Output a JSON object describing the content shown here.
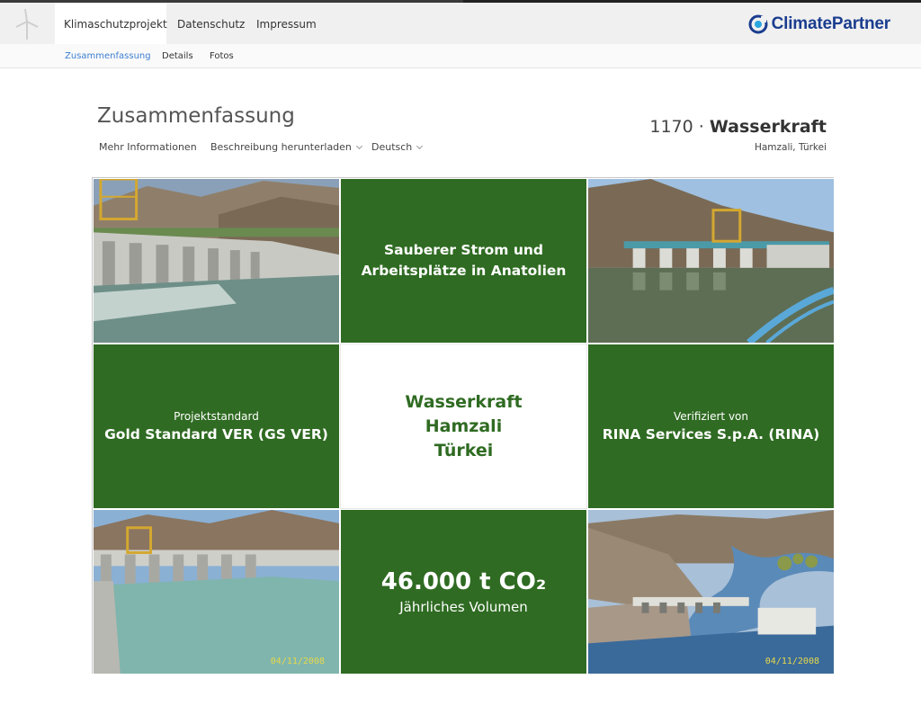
{
  "nav": {
    "tabs": [
      {
        "label": "Klimaschutzprojekt",
        "active": true
      },
      {
        "label": "Datenschutz",
        "active": false
      },
      {
        "label": "Impressum",
        "active": false
      }
    ],
    "brand": "ClimatePartner",
    "brand_color": "#1b3d8f"
  },
  "subnav": {
    "items": [
      {
        "label": "Zusammenfassung",
        "active": true
      },
      {
        "label": "Details",
        "active": false
      },
      {
        "label": "Fotos",
        "active": false
      }
    ]
  },
  "header": {
    "title": "Zusammenfassung",
    "more_info": "Mehr Informationen",
    "download": "Beschreibung herunterladen",
    "language": "Deutsch",
    "project_number": "1170 ·",
    "project_type": "Wasserkraft",
    "location": "Hamzali, Türkei"
  },
  "tiles": {
    "headline_line1": "Sauberer Strom und",
    "headline_line2": "Arbeitsplätze in Anatolien",
    "standard_label": "Projektstandard",
    "standard_value": "Gold Standard VER (GS VER)",
    "center_line1": "Wasserkraft",
    "center_line2": "Hamzali",
    "center_line3": "Türkei",
    "verified_label": "Verifiziert von",
    "verified_value": "RINA Services S.p.A. (RINA)",
    "volume_value": "46.000 t CO₂",
    "volume_label": "Jährliches Volumen",
    "photo_date_1": "04/11/2008",
    "photo_date_2": "04/11/2008"
  },
  "colors": {
    "tile_green": "#2f6b22",
    "active_sub": "#3d7fd1"
  }
}
